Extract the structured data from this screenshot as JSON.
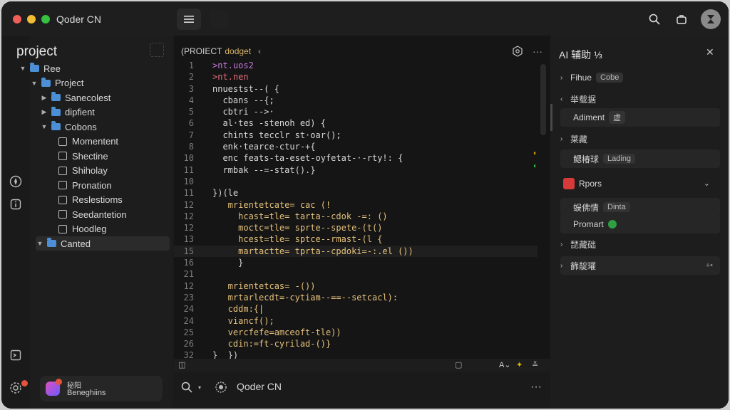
{
  "app": {
    "title": "Qoder CN"
  },
  "titlebar": {
    "icons": [
      "search-icon",
      "share-icon",
      "hourglass-icon"
    ]
  },
  "explorer": {
    "title": "project",
    "tree": [
      {
        "label": "Ree",
        "type": "folder",
        "depth": 0,
        "expanded": true
      },
      {
        "label": "Project",
        "type": "folder",
        "depth": 1,
        "expanded": true
      },
      {
        "label": "Sanecolest",
        "type": "folder",
        "depth": 2,
        "expanded": false
      },
      {
        "label": "dipfient",
        "type": "folder",
        "depth": 2,
        "expanded": false
      },
      {
        "label": "Cobons",
        "type": "folder",
        "depth": 2,
        "expanded": true
      },
      {
        "label": "Momentent",
        "type": "file",
        "depth": 3
      },
      {
        "label": "Shectine",
        "type": "file",
        "depth": 3
      },
      {
        "label": "Shiholay",
        "type": "file",
        "depth": 3
      },
      {
        "label": "Pronation",
        "type": "file",
        "depth": 3
      },
      {
        "label": "Reslestioms",
        "type": "file",
        "depth": 3
      },
      {
        "label": "Seedantetion",
        "type": "file",
        "depth": 3
      },
      {
        "label": "Hoodleg",
        "type": "file",
        "depth": 3
      },
      {
        "label": "Canted",
        "type": "folder",
        "depth": 1,
        "expanded": true,
        "selected": true
      }
    ]
  },
  "user": {
    "line1": "秘阳",
    "line2": "Beneghiins"
  },
  "editor": {
    "tab_path": "(PROIECT",
    "tab_name": "dodget",
    "lines": [
      {
        "n": "1",
        "t": ">nt.uos2"
      },
      {
        "n": "2",
        "t": ">nt.nen"
      },
      {
        "n": "3",
        "t": "nnuestst--( {"
      },
      {
        "n": "4",
        "t": "  cbans --{;"
      },
      {
        "n": "5",
        "t": "  cbtri -->·"
      },
      {
        "n": "6",
        "t": "  al·tes -stenoh ed) {"
      },
      {
        "n": "7",
        "t": "  chints tecclr st·oar();"
      },
      {
        "n": "8",
        "t": "  enk·tearce-ctur-+{"
      },
      {
        "n": "10",
        "t": "  enc feats-ta-eset-oyfetat-·-rty!: {"
      },
      {
        "n": "11",
        "t": "  rmbak --=-stat().}"
      },
      {
        "n": "10",
        "t": ""
      },
      {
        "n": "11",
        "t": "})(le"
      },
      {
        "n": "12",
        "t": "   mrientetcate= cac (!"
      },
      {
        "n": "12",
        "t": "     hcast=tle= tarta--cdok -=: ()"
      },
      {
        "n": "12",
        "t": "     moctc=tle= sprte--spete-(t()"
      },
      {
        "n": "13",
        "t": "     hcest=tle= sptce--rmast-(l {"
      },
      {
        "n": "15",
        "t": "     martactte= tprta--cpdoki=-:.el ())"
      },
      {
        "n": "16",
        "t": "     }"
      },
      {
        "n": "21",
        "t": ""
      },
      {
        "n": "12",
        "t": "   mrientetcas= -())"
      },
      {
        "n": "23",
        "t": "   mrtarlecdt=-cytiam--==--setcacl):"
      },
      {
        "n": "24",
        "t": "   cddm:{|"
      },
      {
        "n": "24",
        "t": "   viancf();"
      },
      {
        "n": "25",
        "t": "   vercfefe=amceoft-tle))"
      },
      {
        "n": "26",
        "t": "   cdin:=ft-cyrilad-()}"
      },
      {
        "n": "32",
        "t": "}  })"
      }
    ]
  },
  "bottom": {
    "label": "Qoder CN"
  },
  "ai_panel": {
    "title": "AI 辅助 ⅓",
    "items": [
      {
        "kind": "row",
        "chev": "›",
        "label": "Fihue",
        "pill": "Cobe"
      },
      {
        "kind": "row",
        "chev": "‹",
        "label": "举载据"
      },
      {
        "kind": "card",
        "label": "Adiment",
        "pill": "虚"
      },
      {
        "kind": "row",
        "chev": "›",
        "label": "莱藏"
      },
      {
        "kind": "card",
        "label": "鳃椿球",
        "pill": "Lading"
      },
      {
        "kind": "report",
        "label": "Rpors"
      },
      {
        "kind": "card",
        "label": "蜈佛情",
        "pill": "Dinta"
      },
      {
        "kind": "card",
        "label": "Promart",
        "green": true
      },
      {
        "kind": "row",
        "chev": "›",
        "label": "琵藏础"
      },
      {
        "kind": "row",
        "chev": "›",
        "label": "籂靛瓘",
        "trail": "+•"
      }
    ]
  },
  "colors": {
    "accent": "#4c8fd6",
    "tab_name": "#d9b46a",
    "badge": "#e5533d"
  }
}
